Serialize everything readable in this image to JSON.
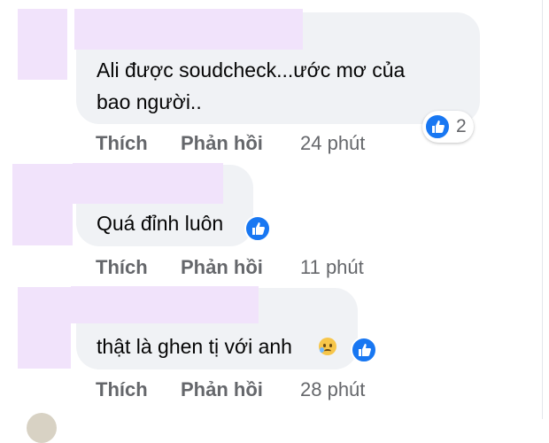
{
  "comments": [
    {
      "text_lines": [
        "Ali được soudcheck...ước mơ của",
        "bao người.."
      ],
      "reaction_count": "2",
      "actions": {
        "like": "Thích",
        "reply": "Phản hồi",
        "time": "24 phút"
      }
    },
    {
      "text_lines": [
        "Quá đỉnh luôn"
      ],
      "actions": {
        "like": "Thích",
        "reply": "Phản hồi",
        "time": "11 phút"
      }
    },
    {
      "text_lines": [
        "thật là ghen tị với anh"
      ],
      "emoji": "sad-tear-emoji",
      "actions": {
        "like": "Thích",
        "reply": "Phản hồi",
        "time": "28 phút"
      }
    }
  ],
  "colors": {
    "bubble": "#f0f2f5",
    "redaction": "#f1e3fb",
    "like_blue": "#1877f2",
    "secondary_text": "#65676b"
  },
  "icons": [
    "like-reaction-icon",
    "sad-tear-emoji"
  ]
}
